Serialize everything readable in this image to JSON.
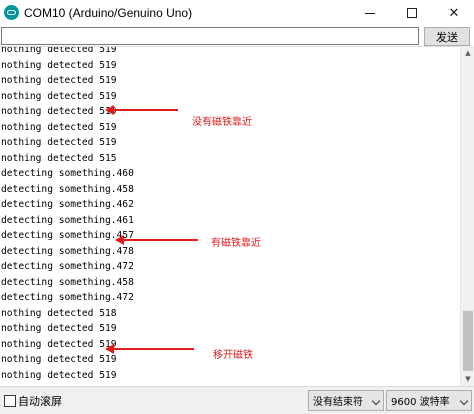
{
  "window": {
    "title": "COM10 (Arduino/Genuino Uno)",
    "close_glyph": "✕",
    "icon": "arduino-icon"
  },
  "input": {
    "value": "",
    "send_label": "发送"
  },
  "output": {
    "lines": [
      "nothing detected 519",
      "nothing detected 519",
      "nothing detected 519",
      "nothing detected 519",
      "nothing detected 519",
      "nothing detected 519",
      "nothing detected 519",
      "nothing detected 515",
      "detecting something.460",
      "detecting something.458",
      "detecting something.462",
      "detecting something.461",
      "detecting something.457",
      "detecting something.478",
      "detecting something.472",
      "detecting something.458",
      "detecting something.472",
      "nothing detected 518",
      "nothing detected 519",
      "nothing detected 519",
      "nothing detected 519",
      "nothing detected 519"
    ]
  },
  "annotations": {
    "color": "#e21b1b",
    "items": [
      {
        "text": "没有磁铁靠近"
      },
      {
        "text": "有磁铁靠近"
      },
      {
        "text": "移开磁铁"
      }
    ]
  },
  "bottom": {
    "autoscroll_label": "自动滚屏",
    "autoscroll_checked": false,
    "line_ending": "没有结束符",
    "baud": "9600 波特率"
  }
}
